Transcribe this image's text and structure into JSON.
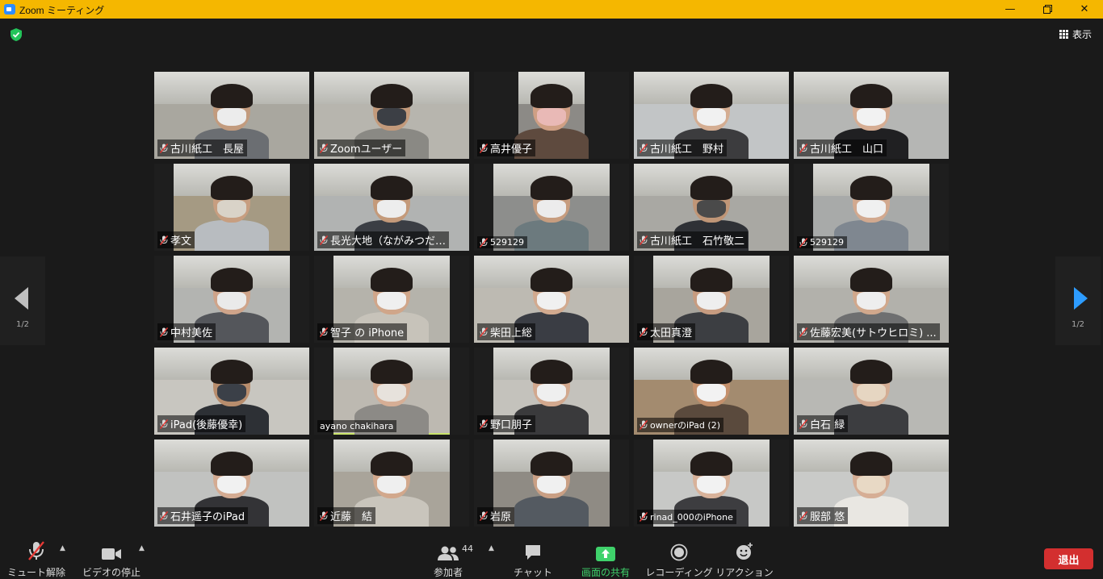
{
  "window": {
    "title": "Zoom ミーティング"
  },
  "header": {
    "view_label": "表示"
  },
  "pagination": {
    "left": "1/2",
    "right": "1/2"
  },
  "participants": [
    {
      "name": "古川紙工　長屋",
      "muted": true,
      "bg": "#a9a79f",
      "skin": "#c29b7e",
      "shirt": "#6b6e72",
      "mask": "#ececec"
    },
    {
      "name": "Zoomユーザー",
      "muted": true,
      "bg": "#b7b5ae",
      "skin": "#c39a7b",
      "shirt": "#8a8984",
      "mask": "#3c3f45"
    },
    {
      "name": "高井優子",
      "muted": true,
      "bg": "#8c8a86",
      "skin": "#cf9f84",
      "shirt": "#5e4a3e",
      "mask": "#e9b9b6"
    },
    {
      "name": "古川紙工　野村",
      "muted": true,
      "bg": "#c2c5c6",
      "skin": "#d4ad92",
      "shirt": "#3c3c3e",
      "mask": "#f1f1f1"
    },
    {
      "name": "古川紙工　山口",
      "muted": true,
      "bg": "#b5b6b4",
      "skin": "#d6ad93",
      "shirt": "#202022",
      "mask": "#f2f2f2"
    },
    {
      "name": "孝文",
      "muted": true,
      "bg": "#a59a83",
      "skin": "#c79e80",
      "shirt": "#b8bcc0",
      "mask": "#d9d3c8"
    },
    {
      "name": "長光大地（ながみつだ…",
      "muted": true,
      "bg": "#b1b3b2",
      "skin": "#c49a7a",
      "shirt": "#3b3e44",
      "mask": "#ededed"
    },
    {
      "name": "529129",
      "muted": true,
      "bg": "#8d8e8c",
      "skin": "#c79d7f",
      "shirt": "#6c7a7e",
      "mask": "#ececec",
      "small": true
    },
    {
      "name": "古川紙工　石竹敬二",
      "muted": true,
      "bg": "#a9a8a3",
      "skin": "#c09677",
      "shirt": "#2f3136",
      "mask": "#4a4a4a"
    },
    {
      "name": "529129",
      "muted": true,
      "bg": "#a8aaa9",
      "skin": "#d2a98f",
      "shirt": "#7f8790",
      "mask": "#f0f0f0",
      "small": true
    },
    {
      "name": "中村美佐",
      "muted": true,
      "bg": "#b3b4b1",
      "skin": "#cfa48a",
      "shirt": "#54565b",
      "mask": "#eaeaea"
    },
    {
      "name": "智子 の iPhone",
      "muted": true,
      "bg": "#b5b3ab",
      "skin": "#d0a68a",
      "shirt": "#c7c3ba",
      "mask": "#efefef"
    },
    {
      "name": "柴田上総",
      "muted": true,
      "bg": "#bdbab2",
      "skin": "#d2aa8f",
      "shirt": "#3a3d44",
      "mask": "#f0f0f0"
    },
    {
      "name": "太田真澄",
      "muted": true,
      "bg": "#a8a59d",
      "skin": "#c79c80",
      "shirt": "#3c3e42",
      "mask": "#eeeeee"
    },
    {
      "name": "佐藤宏美(サトウヒロミ) ...",
      "muted": true,
      "bg": "#b2b1ab",
      "skin": "#d1a88c",
      "shirt": "#6e6f70",
      "mask": "#eeeeee"
    },
    {
      "name": "iPad(後藤優幸)",
      "muted": true,
      "bg": "#c8c6c0",
      "skin": "#b88d6d",
      "shirt": "#2d3035",
      "mask": "#3b4048"
    },
    {
      "name": "ayano chakihara",
      "muted": false,
      "active": true,
      "bg": "#bdb9b1",
      "skin": "#d6ae95",
      "shirt": "#8c8a86",
      "mask": "#e7e2dc",
      "small": true
    },
    {
      "name": "野口朋子",
      "muted": true,
      "bg": "#c4c2bc",
      "skin": "#d2a88e",
      "shirt": "#3a3a3c",
      "mask": "#efefef"
    },
    {
      "name": "ownerのiPad (2)",
      "muted": true,
      "bg": "#a38b6f",
      "skin": "#c4906c",
      "shirt": "#5a4a3d",
      "mask": "#f2f2f2",
      "small": true
    },
    {
      "name": "白石 緑",
      "muted": true,
      "bg": "#b8b8b4",
      "skin": "#d4ad94",
      "shirt": "#3c3d40",
      "mask": "#e6d6c2"
    },
    {
      "name": "石井遥子のiPad",
      "muted": true,
      "bg": "#c1c2c0",
      "skin": "#d4ab92",
      "shirt": "#333336",
      "mask": "#f1f1f1"
    },
    {
      "name": "近藤　結",
      "muted": true,
      "bg": "#a9a49a",
      "skin": "#d2a88c",
      "shirt": "#c9c5bc",
      "mask": "#efefef"
    },
    {
      "name": "岩原",
      "muted": true,
      "bg": "#8f8b84",
      "skin": "#c99f84",
      "shirt": "#545a61",
      "mask": "#f0f0f0"
    },
    {
      "name": "rinad_000のiPhone",
      "muted": true,
      "bg": "#c7c8c6",
      "skin": "#d8b29a",
      "shirt": "#3d3d40",
      "mask": "#f2f2f2",
      "small": true
    },
    {
      "name": "服部 悠",
      "muted": true,
      "bg": "#c9cac8",
      "skin": "#d6ae95",
      "shirt": "#e9e7e2",
      "mask": "#e8d9c5"
    }
  ],
  "toolbar": {
    "mute_label": "ミュート解除",
    "video_label": "ビデオの停止",
    "participants_label": "参加者",
    "participants_count": "44",
    "chat_label": "チャット",
    "share_label": "画面の共有",
    "record_label": "レコーディング",
    "reaction_label": "リアクション",
    "leave_label": "退出"
  },
  "colors": {
    "titlebar": "#f5b700",
    "share_green": "#3fd26b",
    "leave_red": "#d32f2f",
    "active_border": "#c9e36b",
    "nav_arrow": "#2d9cff"
  }
}
